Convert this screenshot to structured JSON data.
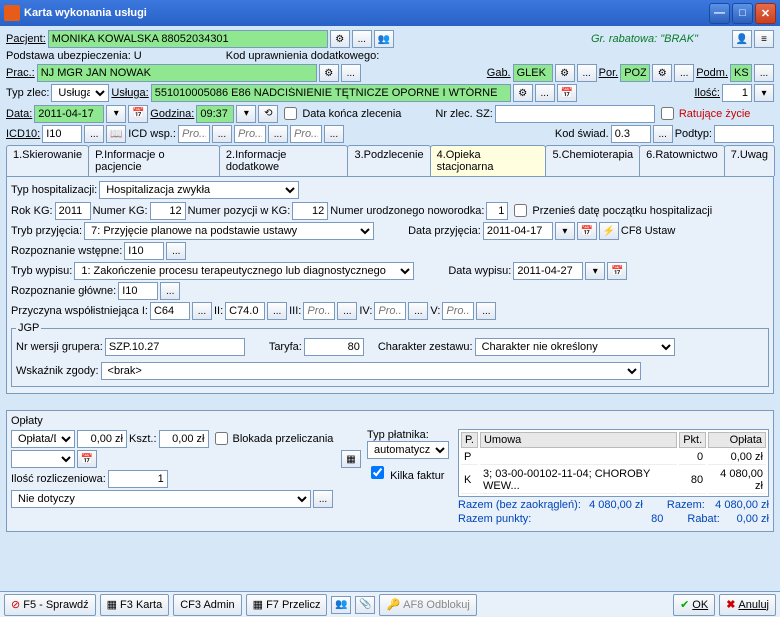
{
  "title": "Karta wykonania usługi",
  "header": {
    "pacjentLbl": "Pacjent:",
    "pacjent": "MONIKA KOWALSKA 88052034301",
    "grRabatowa": "Gr. rabatowa: \"BRAK\"",
    "podstawaUbezp": "Podstawa ubezpieczenia: U",
    "kodUpraw": "Kod uprawnienia dodatkowego:",
    "pracLbl": "Prac.:",
    "prac": "NJ MGR JAN NOWAK",
    "gabLbl": "Gab.",
    "gab": "GLEK (",
    "porLbl": "Por.",
    "por": "POZ",
    "podmLbl": "Podm.",
    "podm": "KS",
    "typZlecLbl": "Typ zlec:",
    "typZlec": "Usługa",
    "uslugaLbl": "Usługa:",
    "usluga": "551010005086 E86 NADCIŚNIENIE TĘTNICZE OPORNE I WTÓRNE",
    "iloscLbl": "Ilość:",
    "ilosc": "1",
    "dataLbl": "Data:",
    "data": "2011-04-17",
    "godzinaLbl": "Godzina:",
    "godzina": "09:37",
    "dataKonca": "Data końca zlecenia",
    "nrZlecLbl": "Nr zlec. SZ:",
    "nrZlec": "",
    "ratujace": "Ratujące życie",
    "icd10Lbl": "ICD10:",
    "icd10": "I10",
    "icdWspLbl": "ICD wsp.:",
    "icdWspPh": "Pro...",
    "kodSwiadLbl": "Kod świad.",
    "kodSwiad": "0.3",
    "podtypLbl": "Podtyp:",
    "podtyp": ""
  },
  "tabs": [
    "1.Skierowanie",
    "P.Informacje o pacjencie",
    "2.Informacje dodatkowe",
    "3.Podzlecenie",
    "4.Opieka stacjonarna",
    "5.Chemioterapia",
    "6.Ratownictwo",
    "7.Uwag"
  ],
  "activeTab": 4,
  "op": {
    "typHospLbl": "Typ hospitalizacji:",
    "typHosp": "Hospitalizacja zwykła",
    "rokKGLbl": "Rok KG:",
    "rokKG": "2011",
    "numerKGLbl": "Numer KG:",
    "numerKG": "12",
    "pozycjiLbl": "Numer pozycji w KG:",
    "pozycji": "12",
    "noworodkaLbl": "Numer urodzonego noworodka:",
    "noworodka": "1",
    "przenies": "Przenieś datę początku hospitalizacji",
    "trybPrzLbl": "Tryb przyjęcia:",
    "trybPrz": "7: Przyjęcie planowe na podstawie ustawy",
    "dataPrzLbl": "Data przyjęcia:",
    "dataPrz": "2011-04-17",
    "cf8": "CF8 Ustaw",
    "rozpWstLbl": "Rozpoznanie wstępne:",
    "rozpWst": "I10",
    "trybWypLbl": "Tryb wypisu:",
    "trybWyp": "1: Zakończenie procesu terapeutycznego lub diagnostycznego",
    "dataWypLbl": "Data wypisu:",
    "dataWyp": "2011-04-27",
    "rozpGlLbl": "Rozpoznanie główne:",
    "rozpGl": "I10",
    "przyczynaLbl": "Przyczyna współistniejąca I:",
    "przI": "C64",
    "IILbl": "II:",
    "przII": "C74.0",
    "IIILbl": "III:",
    "IVLbl": "IV:",
    "VLbl": "V:",
    "ph": "Pro...",
    "jgpLbl": "JGP",
    "nrWersjiLbl": "Nr wersji grupera:",
    "nrWersji": "SZP.10.27",
    "taryfaLbl": "Taryfa:",
    "taryfa": "80",
    "charakterLbl": "Charakter zestawu:",
    "charakter": "Charakter nie określony",
    "wskaznikLbl": "Wskaźnik zgody:",
    "wskaznik": "<brak>"
  },
  "oplaty": {
    "title": "Opłaty",
    "oplataDLbl": "Opłata/D",
    "oplataD": "0,00 zł",
    "ksztLbl": "Kszt.:",
    "kszt": "0,00 zł",
    "blokada": "Blokada przeliczania",
    "typPlatLbl": "Typ płatnika:",
    "typPlat": "automatyczn",
    "kilka": "Kilka faktur",
    "iloscRozLbl": "Ilość rozliczeniowa:",
    "iloscRoz": "1",
    "nieDotyczy": "Nie dotyczy",
    "th": {
      "p": "P.",
      "umowa": "Umowa",
      "pkt": "Pkt.",
      "oplata": "Opłata"
    },
    "rows": [
      {
        "p": "P",
        "umowa": "",
        "pkt": "0",
        "opl": "0,00 zł"
      },
      {
        "p": "K",
        "umowa": "3; 03-00-00102-11-04; CHOROBY WEW...",
        "pkt": "80",
        "opl": "4 080,00 zł"
      }
    ],
    "razemBez": "Razem (bez zaokrągleń):",
    "razemBezV": "4 080,00 zł",
    "razemPkt": "Razem punkty:",
    "razemPktV": "80",
    "razem": "Razem:",
    "razemV": "4 080,00 zł",
    "rabat": "Rabat:",
    "rabatV": "0,00 zł"
  },
  "footer": {
    "f5": "F5 - Sprawdź",
    "f3": "F3 Karta",
    "cf3": "CF3 Admin",
    "f7": "F7 Przelicz",
    "af8": "AF8 Odblokuj",
    "ok": "OK",
    "anuluj": "Anuluj"
  }
}
